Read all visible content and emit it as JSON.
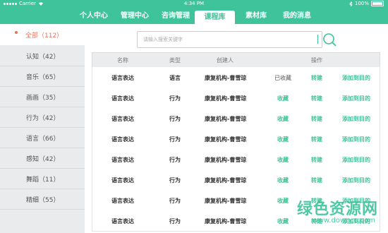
{
  "status": {
    "carrier": "Carrier",
    "time": "4:34 PM",
    "battery": "100%"
  },
  "tabs": [
    "个人中心",
    "管理中心",
    "咨询管理",
    "课程库",
    "素材库",
    "我的消息"
  ],
  "sidebar": {
    "all": "全部（112）",
    "items": [
      "认知（42）",
      "音乐（65）",
      "画画（35）",
      "行为（42）",
      "语言（66）",
      "感知（42）",
      "舞蹈（11）",
      "精细（55）"
    ]
  },
  "search": {
    "placeholder": "请输入搜索关键字"
  },
  "table": {
    "headers": [
      "名称",
      "类型",
      "创建人",
      "操作"
    ],
    "rows": [
      {
        "name": "语言表达",
        "type": "语言",
        "creator": "康复机构-曹雪琼",
        "fav": "已收藏",
        "transfer": "转建",
        "add": "添加到目的"
      },
      {
        "name": "语言表达",
        "type": "行为",
        "creator": "康复机构-曹雪琼",
        "fav": "收藏",
        "transfer": "转建",
        "add": "添加到目的"
      },
      {
        "name": "语言表达",
        "type": "行为",
        "creator": "康复机构-曹雪琼",
        "fav": "收藏",
        "transfer": "转建",
        "add": "添加到目的"
      },
      {
        "name": "语言表达",
        "type": "行为",
        "creator": "康复机构-曹雪琼",
        "fav": "收藏",
        "transfer": "转建",
        "add": "添加到目的"
      },
      {
        "name": "语言表达",
        "type": "行为",
        "creator": "康复机构-曹雪琼",
        "fav": "收藏",
        "transfer": "转建",
        "add": "添加到目的"
      },
      {
        "name": "语言表达",
        "type": "行为",
        "creator": "康复机构-曹雪琼",
        "fav": "收藏",
        "transfer": "转建",
        "add": "添加到目的"
      },
      {
        "name": "语言表达",
        "type": "行为",
        "creator": "康复机构-曹雪琼",
        "fav": "收藏",
        "transfer": "转建",
        "add": "添加到目的"
      },
      {
        "name": "语言表达",
        "type": "行为",
        "creator": "康复机构-曹雪琼",
        "fav": "收藏",
        "transfer": "转建",
        "add": "添加到目的"
      }
    ]
  },
  "watermark": {
    "text": "绿色资源网",
    "url": "www.downcc.com"
  },
  "colors": {
    "accent": "#3ec39a",
    "highlight": "#e8725a"
  }
}
